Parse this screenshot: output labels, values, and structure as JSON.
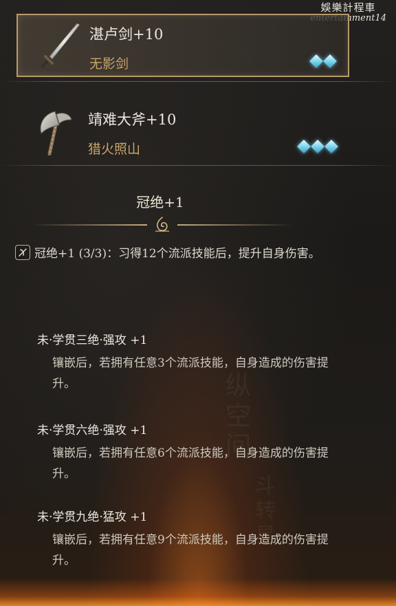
{
  "watermark": {
    "chinese": "娛樂計程車",
    "english": "entertainment14"
  },
  "items": [
    {
      "name": "湛卢剑+10",
      "subtitle": "无影剑",
      "gems": 2,
      "icon": "sword-icon",
      "selected": true
    },
    {
      "name": "靖难大斧+10",
      "subtitle": "猎火照山",
      "gems": 3,
      "icon": "axe-icon",
      "selected": false
    }
  ],
  "section": {
    "title": "冠绝+1",
    "emblem_icon": "ornament-icon"
  },
  "effect": {
    "icon": "skill-icon",
    "text": "冠绝+1 (3/3)：习得12个流派技能后，提升自身伤害。"
  },
  "perks": [
    {
      "title": "未·学贯三绝·强攻 +1",
      "desc_line1": "镶嵌后，若拥有任意3个流派技能，自身造成的伤害提",
      "desc_line2": "升。"
    },
    {
      "title": "未·学贯六绝·强攻 +1",
      "desc_line1": "镶嵌后，若拥有任意6个流派技能，自身造成的伤害提",
      "desc_line2": "升。"
    },
    {
      "title": "未·学贯九绝·猛攻 +1",
      "desc_line1": "镶嵌后，若拥有任意9个流派技能，自身造成的伤害提",
      "desc_line2": "升。"
    }
  ],
  "colors": {
    "gold_text": "#c9a46b",
    "gem": "#7fd6ee",
    "frame": "#b89a6a"
  }
}
